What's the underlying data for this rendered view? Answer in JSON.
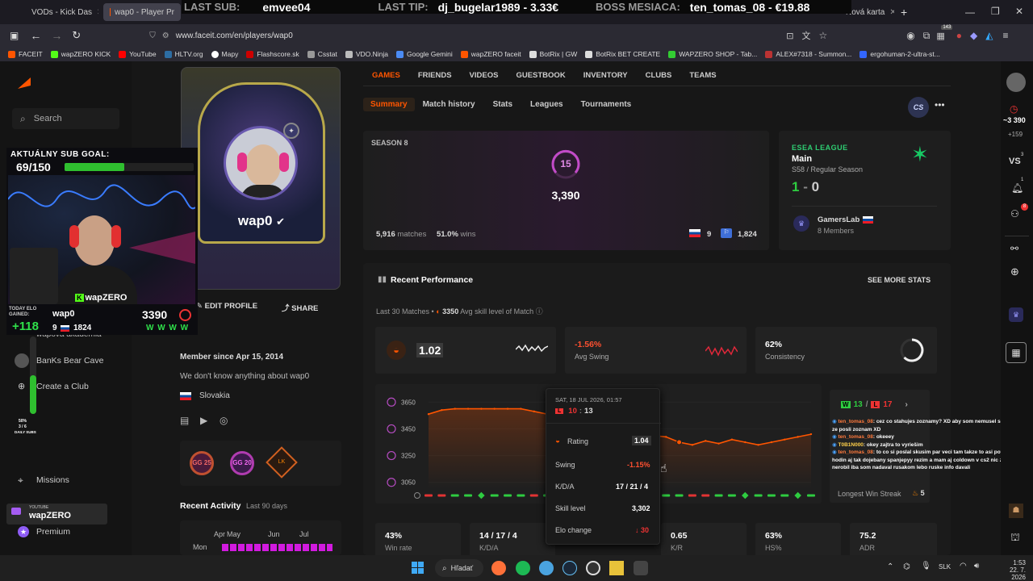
{
  "browser": {
    "tabs": [
      {
        "label": "VODs - Kick Das"
      },
      {
        "label": "wap0 - Player Pr"
      },
      {
        "label": "Nová karta"
      }
    ],
    "url": "www.faceit.com/en/players/wap0",
    "notification_badge": "143",
    "bookmarks": [
      "FACEIT",
      "wapZERO KICK",
      "YouTube",
      "HLTV.org",
      "Mapy",
      "Flashscore.sk",
      "Csstat",
      "VDO.Ninja",
      "Google Gemini",
      "wapZERO faceit",
      "BotRix | GW",
      "BotRix BET CREATE",
      "WAPZERO SHOP - Tab...",
      "ALEX#7318 - Summon...",
      "ergohuman-2-ultra-st..."
    ]
  },
  "stream_banner": {
    "last_sub_label": "LAST SUB:",
    "last_sub": "emvee04",
    "last_tip_label": "LAST TIP:",
    "last_tip": "dj_bugelar1989 - 3.33€",
    "boss_label": "BOSS MESIACA:",
    "boss": "ten_tomas_08 - €19.88"
  },
  "stream_overlay": {
    "sub_goal_label": "AKTUÁLNY SUB GOAL:",
    "sub_goal_value": "69/150",
    "sub_goal_progress": 0.46,
    "channel": "wapZERO",
    "today_elo_label": "TODAY ELO GAINED:",
    "today_elo": "+118",
    "player": "wap0",
    "elo": "3390",
    "level_badge": "9",
    "rank_pos": "1824",
    "recent": "W W W W",
    "daily_subs_pct": "50%",
    "daily_subs_count": "3 / 6",
    "daily_subs_label": "DAILY SUBS"
  },
  "left_nav": {
    "search_label": "Search",
    "clubs": [
      {
        "label": "wapova akademia"
      },
      {
        "label": "BanKs Bear Cave"
      }
    ],
    "create_club": "Create a Club",
    "missions": "Missions",
    "youtube_label": "YOUTUBE",
    "yt_channel": "wapZERO",
    "premium": "Premium"
  },
  "profile": {
    "nickname": "wap0",
    "edit_profile": "EDIT PROFILE",
    "share": "SHARE",
    "member_since": "Member since Apr 15, 2014",
    "bio": "We don't know anything about wap0",
    "country": "Slovakia",
    "badges": [
      "GG 25",
      "GG 20",
      "LK"
    ],
    "recent_activity_title": "Recent Activity",
    "recent_activity_period": "Last 90 days",
    "activity_months": [
      "Apr",
      "May",
      "Jun",
      "Jul"
    ],
    "activity_day": "Mon"
  },
  "tabs": {
    "main": [
      "GAMES",
      "FRIENDS",
      "VIDEOS",
      "GUESTBOOK",
      "INVENTORY",
      "CLUBS",
      "TEAMS"
    ],
    "sub": [
      "Summary",
      "Match history",
      "Stats",
      "Leagues",
      "Tournaments"
    ],
    "game_badge": "CS"
  },
  "season": {
    "label": "SEASON 8",
    "level": "15",
    "elo": "3,390",
    "matches": "5,916",
    "matches_label": "matches",
    "winrate": "51.0%",
    "wins_label": "wins",
    "country_rank": "9",
    "region_rank": "1,824"
  },
  "esea": {
    "label": "ESEA LEAGUE",
    "division": "Main",
    "season": "S58 / Regular Season",
    "wins": "1",
    "dash": "-",
    "losses": "0",
    "team": "GamersLab",
    "members": "8 Members"
  },
  "performance": {
    "title": "Recent Performance",
    "see_more": "SEE MORE STATS",
    "subtitle_prefix": "Last 30 Matches •",
    "avg_skill": "3350",
    "avg_skill_label": "Avg skill level of Match",
    "rating": "1.02",
    "swing": "-1.56%",
    "swing_label": "Avg Swing",
    "consistency": "62%",
    "consistency_label": "Consistency",
    "wl_wins": "13",
    "wl_sep": "/",
    "wl_losses": "17",
    "streak_label": "Longest Win Streak",
    "streak_value": "5",
    "bottom": [
      {
        "value": "43%",
        "label": "Win rate"
      },
      {
        "value": "14 / 17 / 4",
        "label": "K/D/A"
      },
      {
        "value": "0.65",
        "label": "K/R"
      },
      {
        "value": "63%",
        "label": "HS%"
      },
      {
        "value": "75.2",
        "label": "ADR"
      }
    ]
  },
  "tooltip": {
    "date": "SAT, 18 JUL 2026, 01:57",
    "score_loss": "10",
    "score_sep": ":",
    "score_win": "13",
    "rows": [
      {
        "label": "Rating",
        "value": "1.04"
      },
      {
        "label": "Swing",
        "value": "-1.15%"
      },
      {
        "label": "K/D/A",
        "value": "17 / 21 / 4"
      },
      {
        "label": "Skill level",
        "value": "3,302"
      },
      {
        "label": "Elo change",
        "value": "↓ 30"
      }
    ]
  },
  "chat": [
    {
      "user": "ten_tomas_08",
      "text": ": cez co stahujes zoznamy? XD aby som nemusel s tym srat ze posli zoznam XD"
    },
    {
      "user": "ten_tomas_08",
      "text": ": okeeey"
    },
    {
      "user": "T0B1N000",
      "text": ": okey zajtra to vyriešim"
    },
    {
      "user": "ten_tomas_08",
      "text": ": to co si poslal skusim par veci tam takze to asi potrva par hodin aj tak dojebany spanjepyy rezim a mam aj coldown v cs2 nic zle som nerobil iba som nadaval rusakom lebo ruske info davali"
    }
  ],
  "chart_data": {
    "type": "line",
    "title": "",
    "xlabel": "",
    "ylabel": "",
    "yticks": [
      "3650",
      "3450",
      "3250",
      "3050"
    ],
    "ylim": [
      3000,
      3700
    ],
    "x": [
      1,
      2,
      3,
      4,
      5,
      6,
      7,
      8,
      9,
      10,
      11,
      12,
      13,
      14,
      15,
      16,
      17,
      18,
      19,
      20,
      21,
      22,
      23,
      24,
      25,
      26,
      27,
      28,
      29,
      30
    ],
    "series": [
      {
        "values": [
          3560,
          3590,
          3600,
          3600,
          3600,
          3600,
          3600,
          3600,
          3580,
          3560,
          3540,
          3520,
          3500,
          3480,
          3460,
          3440,
          3420,
          3400,
          3390,
          3350,
          3330,
          3360,
          3340,
          3370,
          3350,
          3330,
          3350,
          3370,
          3390,
          3410
        ]
      }
    ],
    "results": [
      "L",
      "L",
      "W",
      "W",
      "W",
      "W",
      "W",
      "W",
      "L",
      "W",
      "L",
      "L",
      "L",
      "W",
      "L",
      "L",
      "W",
      "L",
      "W",
      "W",
      "L",
      "L",
      "W",
      "W",
      "W",
      "W",
      "W",
      "W",
      "W",
      "W"
    ]
  },
  "right_rail": {
    "points": "~3 390",
    "points_delta": "+159",
    "vs_badge": "3",
    "notif_badge": "1",
    "friends_badge": "8"
  },
  "taskbar": {
    "search": "Hľadať",
    "lang": "SLK",
    "time": "1:53",
    "date": "22. 7. 2026"
  },
  "colors": {
    "accent": "#ff5500",
    "win": "#2ecc40",
    "loss": "#e33333",
    "level": "#c24bc8"
  }
}
